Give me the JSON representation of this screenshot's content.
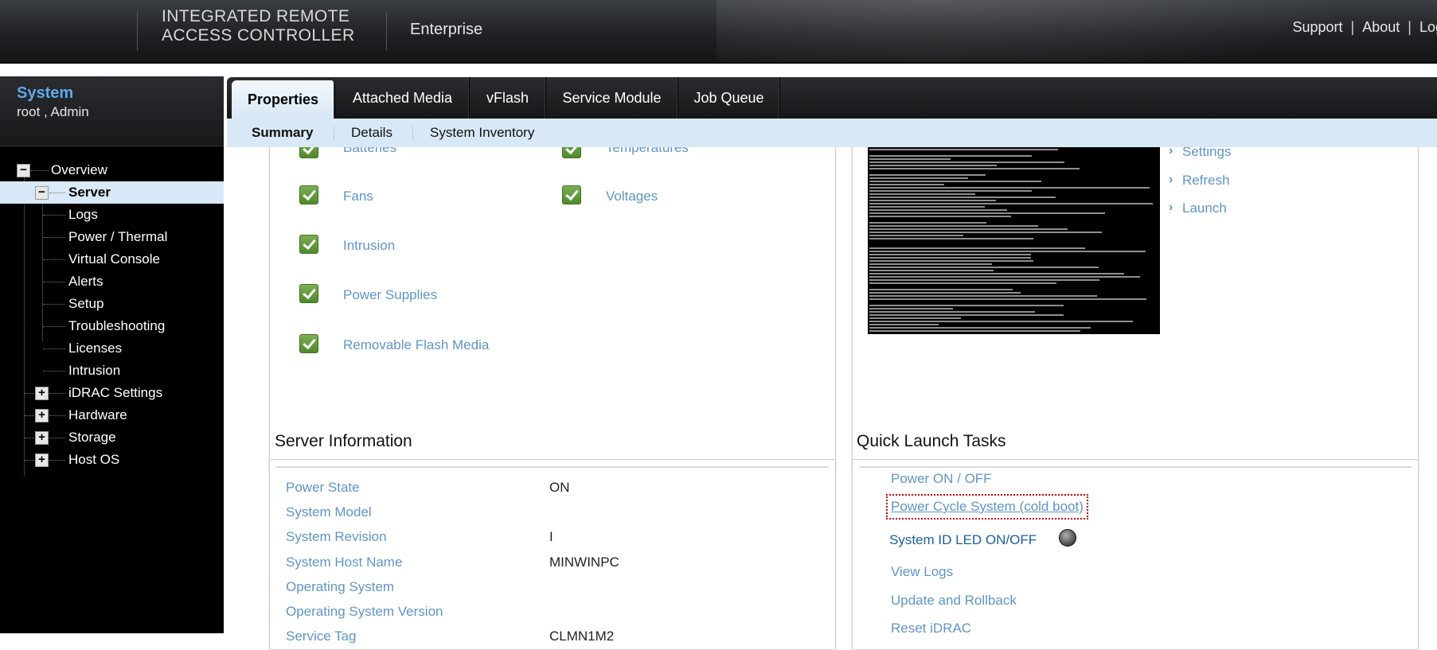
{
  "header": {
    "brand_line1": "INTEGRATED REMOTE",
    "brand_line2": "ACCESS CONTROLLER",
    "edition": "Enterprise",
    "links": [
      "Support",
      "About",
      "Log"
    ]
  },
  "sidebar": {
    "system_label": "System",
    "user_label": "root , Admin",
    "tree": [
      {
        "label": "Overview",
        "expander": "−"
      },
      {
        "label": "Server",
        "expander": "−"
      },
      {
        "label": "Logs"
      },
      {
        "label": "Power / Thermal"
      },
      {
        "label": "Virtual Console"
      },
      {
        "label": "Alerts"
      },
      {
        "label": "Setup"
      },
      {
        "label": "Troubleshooting"
      },
      {
        "label": "Licenses"
      },
      {
        "label": "Intrusion"
      },
      {
        "label": "iDRAC Settings",
        "expander": "+"
      },
      {
        "label": "Hardware",
        "expander": "+"
      },
      {
        "label": "Storage",
        "expander": "+"
      },
      {
        "label": "Host OS",
        "expander": "+"
      }
    ]
  },
  "tabs": [
    "Properties",
    "Attached Media",
    "vFlash",
    "Service Module",
    "Job Queue"
  ],
  "subtabs": [
    "Summary",
    "Details",
    "System Inventory"
  ],
  "health": {
    "left": [
      "Batteries",
      "Fans",
      "Intrusion",
      "Power Supplies",
      "Removable Flash Media"
    ],
    "right": [
      "Temperatures",
      "Voltages"
    ]
  },
  "console_links": [
    "Settings",
    "Refresh",
    "Launch"
  ],
  "server_info": {
    "title": "Server Information",
    "rows": [
      {
        "label": "Power State",
        "value": "ON"
      },
      {
        "label": "System Model",
        "value": ""
      },
      {
        "label": "System Revision",
        "value": "I"
      },
      {
        "label": "System Host Name",
        "value": "MINWINPC"
      },
      {
        "label": "Operating System",
        "value": ""
      },
      {
        "label": "Operating System Version",
        "value": ""
      },
      {
        "label": "Service Tag",
        "value": "CLMN1M2"
      }
    ]
  },
  "quick_launch": {
    "title": "Quick Launch Tasks",
    "items": [
      "Power ON / OFF",
      "Power Cycle System (cold boot)",
      "System ID LED ON/OFF",
      "View Logs",
      "Update and Rollback",
      "Reset iDRAC"
    ]
  },
  "colors": {
    "link": "#5f95c8",
    "system_label": "#5fa8e8",
    "subtab_bg": "#d9e8f6",
    "ok_green": "#5a9a35"
  }
}
